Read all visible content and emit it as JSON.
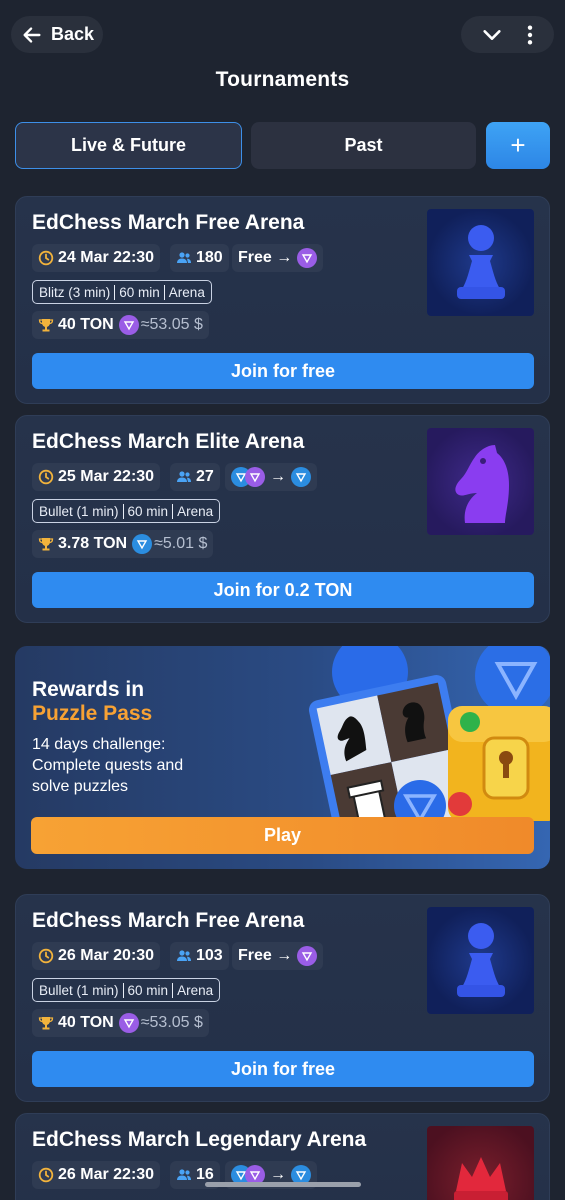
{
  "header": {
    "back_label": "Back",
    "title": "Tournaments"
  },
  "tabs": [
    {
      "label": "Live & Future",
      "active": true
    },
    {
      "label": "Past",
      "active": false
    },
    {
      "label": "+",
      "active": false
    }
  ],
  "tournaments": [
    {
      "title": "EdChess March Free Arena",
      "date": "24 Mar 22:30",
      "players": "180",
      "entry": "Free →",
      "format": [
        "Blitz (3 min)",
        "60 min",
        "Arena"
      ],
      "prize": "40 TON",
      "prize_usd": "≈53.05 $",
      "button": "Join for free",
      "piece_icon": "pawn-icon"
    },
    {
      "title": "EdChess March Elite Arena",
      "date": "25 Mar 22:30",
      "players": "27",
      "entry": "→",
      "format": [
        "Bullet (1 min)",
        "60 min",
        "Arena"
      ],
      "prize": "3.78 TON",
      "prize_usd": "≈5.01 $",
      "button": "Join for 0.2 TON",
      "piece_icon": "knight-icon"
    },
    {
      "title": "EdChess March Free Arena",
      "date": "26 Mar 20:30",
      "players": "103",
      "entry": "Free →",
      "format": [
        "Bullet (1 min)",
        "60 min",
        "Arena"
      ],
      "prize": "40 TON",
      "prize_usd": "≈53.05 $",
      "button": "Join for free",
      "piece_icon": "pawn-icon"
    },
    {
      "title": "EdChess March Legendary Arena",
      "date": "26 Mar 22:30",
      "players": "16",
      "entry": "→",
      "piece_icon": "king-icon"
    }
  ],
  "promo": {
    "title_line1": "Rewards in",
    "title_line2": "Puzzle Pass",
    "description": "14 days challenge: Complete quests and solve puzzles",
    "button": "Play"
  },
  "colors": {
    "background": "#1e2430",
    "card": "#26334b",
    "accent_blue": "#2f8bf0",
    "accent_orange": "#f7a234",
    "coin_purple": "#9a5de6",
    "coin_blue": "#2b8de0"
  }
}
